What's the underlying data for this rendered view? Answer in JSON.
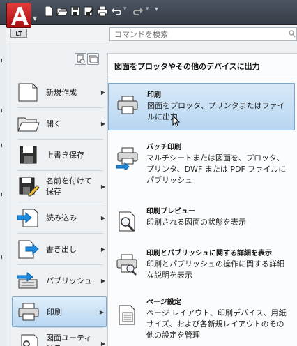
{
  "app": {
    "badge": "LT",
    "accent": "#c8171b"
  },
  "qat": {
    "icons": [
      "new-icon",
      "open-icon",
      "save-icon",
      "saveas-icon",
      "print-icon",
      "undo-icon",
      "redo-icon",
      "customize-icon"
    ]
  },
  "search": {
    "placeholder": "コマンドを検索"
  },
  "menu": {
    "commands": [
      {
        "label": "新規作成",
        "icon": "new-document-icon",
        "has_arrow": true
      },
      {
        "label": "開く",
        "icon": "open-folder-icon",
        "has_arrow": true
      },
      {
        "label": "上書き保存",
        "icon": "save-icon",
        "has_arrow": false
      },
      {
        "label": "名前を付けて保存",
        "icon": "save-as-icon",
        "has_arrow": true
      },
      {
        "label": "読み込み",
        "icon": "import-icon",
        "has_arrow": true
      },
      {
        "label": "書き出し",
        "icon": "export-icon",
        "has_arrow": true
      },
      {
        "label": "パブリッシュ",
        "icon": "publish-icon",
        "has_arrow": true
      },
      {
        "label": "印刷",
        "icon": "print-icon",
        "has_arrow": true,
        "selected": true
      },
      {
        "label": "図面ユーティリティ",
        "icon": "drawing-utilities-icon",
        "has_arrow": true
      }
    ]
  },
  "panel": {
    "title": "図面をプロッタやその他のデバイスに出力",
    "options": [
      {
        "title": "印刷",
        "desc": "図面をプロッタ、プリンタまたはファイルに出力",
        "icon": "plot-icon",
        "hover": true
      },
      {
        "title": "バッチ印刷",
        "desc": "マルチシートまたは図面を、プロッタ、プリンタ、DWF または PDF ファイルにパブリッシュ",
        "icon": "batch-plot-icon"
      },
      {
        "title": "印刷プレビュー",
        "desc": "印刷される図面の状態を表示",
        "icon": "plot-preview-icon"
      },
      {
        "title": "印刷とパブリッシュに関する詳細を表示",
        "desc": "印刷とパブリッシュの操作に関する詳細な説明を表示",
        "icon": "plot-details-icon"
      },
      {
        "title": "ページ設定",
        "desc": "ページ レイアウト、印刷デバイス、用紙サイズ、および各新規レイアウトのその他の設定を管理",
        "icon": "page-setup-icon"
      }
    ]
  }
}
